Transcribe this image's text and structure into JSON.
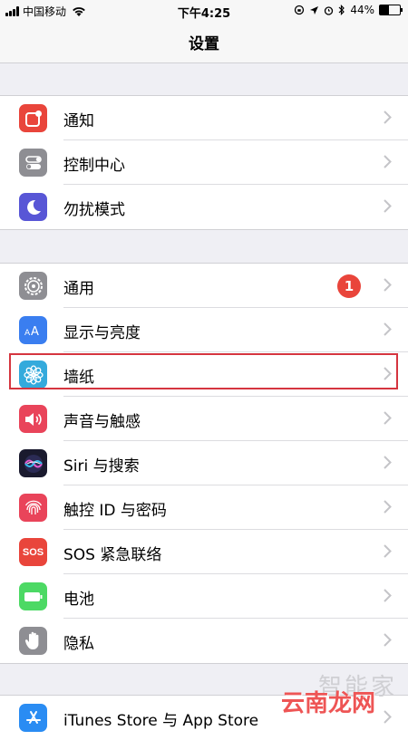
{
  "status": {
    "carrier": "中国移动",
    "time": "下午4:25",
    "battery_pct": "44%",
    "battery_level": 0.44
  },
  "nav": {
    "title": "设置"
  },
  "group1": {
    "notifications": "通知",
    "control_center": "控制中心",
    "dnd": "勿扰模式"
  },
  "group2": {
    "general": "通用",
    "general_badge": "1",
    "display": "显示与亮度",
    "wallpaper": "墙纸",
    "sounds": "声音与触感",
    "siri": "Siri 与搜索",
    "touch_id": "触控 ID 与密码",
    "sos": "SOS 紧急联络",
    "sos_icon_text": "SOS",
    "battery": "电池",
    "privacy": "隐私"
  },
  "group3": {
    "itunes": "iTunes Store 与 App Store"
  },
  "icons": {
    "notifications": "notifications-icon",
    "control_center": "control-center-icon",
    "dnd": "moon-icon",
    "general": "gear-icon",
    "display": "display-aa-icon",
    "wallpaper": "flower-icon",
    "sounds": "speaker-icon",
    "siri": "siri-icon",
    "touch_id": "fingerprint-icon",
    "sos": "sos-icon",
    "battery": "battery-icon",
    "privacy": "hand-icon",
    "itunes": "app-store-icon"
  },
  "colors": {
    "notifications": "#e9453b",
    "control_center": "#8e8e93",
    "dnd": "#5856d6",
    "general": "#8e8e93",
    "display": "#3a7ef0",
    "wallpaper": "#34aadc",
    "sounds": "#e9445a",
    "siri": "#1a1a2e",
    "touch_id": "#e9445a",
    "sos": "#e9453b",
    "battery": "#4cd964",
    "privacy": "#8e8e93",
    "itunes": "#2a8cf3",
    "highlight": "#d5353f"
  },
  "watermark": {
    "text1": "智能家",
    "text2": "云南龙网"
  }
}
